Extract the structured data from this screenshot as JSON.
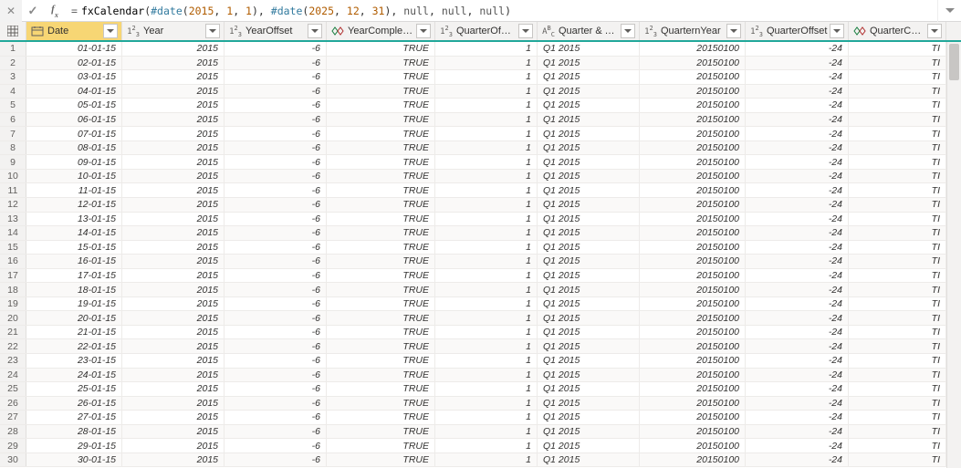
{
  "formula": {
    "prefix": "= ",
    "fn": "fxCalendar",
    "args_html": "(<span class='tok-kw'>#date</span>(<span class='tok-num'>2015</span>, <span class='tok-num'>1</span>, <span class='tok-num'>1</span>), <span class='tok-kw'>#date</span>(<span class='tok-num'>2025</span>, <span class='tok-num'>12</span>, <span class='tok-num'>31</span>), <span class='tok-n'>null</span>, <span class='tok-n'>null</span>, <span class='tok-n'>null</span>)"
  },
  "columns": [
    {
      "id": "Date",
      "label": "Date",
      "type": "date",
      "selected": true,
      "align": "r"
    },
    {
      "id": "Year",
      "label": "Year",
      "type": "int",
      "align": "r"
    },
    {
      "id": "YearOffset",
      "label": "YearOffset",
      "type": "int",
      "align": "r"
    },
    {
      "id": "YearCompleted",
      "label": "YearCompleted",
      "type": "bool",
      "align": "r"
    },
    {
      "id": "QuarterOfYear",
      "label": "QuarterOfYear",
      "type": "int",
      "align": "r"
    },
    {
      "id": "QuarterAndYear",
      "label": "Quarter & Year",
      "type": "text",
      "align": "l"
    },
    {
      "id": "QuarternYear",
      "label": "QuarternYear",
      "type": "int",
      "align": "r"
    },
    {
      "id": "QuarterOffset",
      "label": "QuarterOffset",
      "type": "int",
      "align": "r"
    },
    {
      "id": "QuarterCompleted",
      "label": "QuarterCompleted",
      "type": "bool",
      "align": "r"
    }
  ],
  "col_type_glyph": {
    "date": "date",
    "int": "int",
    "bool": "bool",
    "text": "text"
  },
  "data_template": {
    "Year": "2015",
    "YearOffset": "-6",
    "YearCompleted": "TRUE",
    "QuarterOfYear": "1",
    "QuarterAndYear": "Q1 2015",
    "QuarternYear": "20150100",
    "QuarterOffset": "-24",
    "QuarterCompleted": "TI"
  },
  "date_prefix_pad": "",
  "rows": [
    {
      "n": 1,
      "Date": "01-01-15"
    },
    {
      "n": 2,
      "Date": "02-01-15"
    },
    {
      "n": 3,
      "Date": "03-01-15"
    },
    {
      "n": 4,
      "Date": "04-01-15"
    },
    {
      "n": 5,
      "Date": "05-01-15"
    },
    {
      "n": 6,
      "Date": "06-01-15"
    },
    {
      "n": 7,
      "Date": "07-01-15"
    },
    {
      "n": 8,
      "Date": "08-01-15"
    },
    {
      "n": 9,
      "Date": "09-01-15"
    },
    {
      "n": 10,
      "Date": "10-01-15"
    },
    {
      "n": 11,
      "Date": "11-01-15"
    },
    {
      "n": 12,
      "Date": "12-01-15"
    },
    {
      "n": 13,
      "Date": "13-01-15"
    },
    {
      "n": 14,
      "Date": "14-01-15"
    },
    {
      "n": 15,
      "Date": "15-01-15"
    },
    {
      "n": 16,
      "Date": "16-01-15"
    },
    {
      "n": 17,
      "Date": "17-01-15"
    },
    {
      "n": 18,
      "Date": "18-01-15"
    },
    {
      "n": 19,
      "Date": "19-01-15"
    },
    {
      "n": 20,
      "Date": "20-01-15"
    },
    {
      "n": 21,
      "Date": "21-01-15"
    },
    {
      "n": 22,
      "Date": "22-01-15"
    },
    {
      "n": 23,
      "Date": "23-01-15"
    },
    {
      "n": 24,
      "Date": "24-01-15"
    },
    {
      "n": 25,
      "Date": "25-01-15"
    },
    {
      "n": 26,
      "Date": "26-01-15"
    },
    {
      "n": 27,
      "Date": "27-01-15"
    },
    {
      "n": 28,
      "Date": "28-01-15"
    },
    {
      "n": 29,
      "Date": "29-01-15"
    },
    {
      "n": 30,
      "Date": "30-01-15"
    }
  ]
}
